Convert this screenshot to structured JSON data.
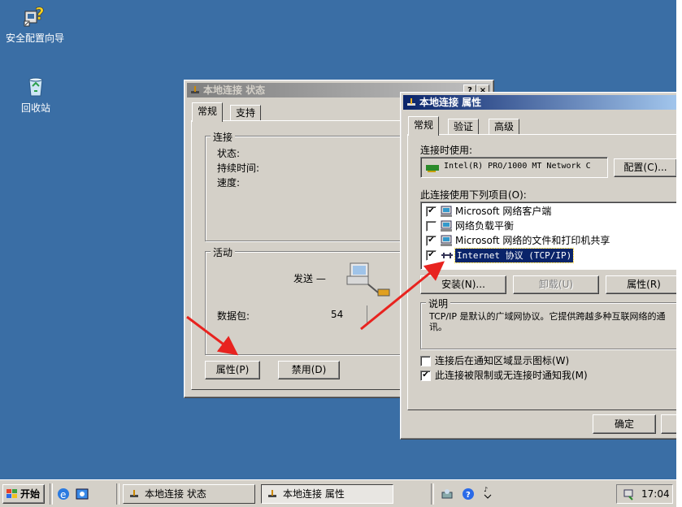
{
  "desktop": {
    "icons": [
      {
        "label": "安全配置向导",
        "icon": "security-wizard-icon"
      },
      {
        "label": "回收站",
        "icon": "recycle-bin-icon"
      }
    ]
  },
  "status_window": {
    "title": "本地连接 状态",
    "help_btn": "?",
    "close_btn": "×",
    "tabs": [
      "常规",
      "支持"
    ],
    "connection_group": "连接",
    "status_label": "状态:",
    "duration_label": "持续时间:",
    "speed_label": "速度:",
    "activity_group": "活动",
    "sent_label": "发送 —",
    "packets_label": "数据包:",
    "packets_sent": "54",
    "properties_btn": "属性(P)",
    "disable_btn": "禁用(D)"
  },
  "props_window": {
    "title": "本地连接 属性",
    "tabs": [
      "常规",
      "验证",
      "高级"
    ],
    "connect_using_label": "连接时使用:",
    "adapter_name": "Intel(R) PRO/1000 MT Network C",
    "configure_btn": "配置(C)...",
    "items_label": "此连接使用下列项目(O):",
    "items": [
      {
        "label": "Microsoft 网络客户端",
        "checked": true,
        "icon": "network-client-icon"
      },
      {
        "label": "网络负载平衡",
        "checked": false,
        "icon": "load-balance-icon"
      },
      {
        "label": "Microsoft 网络的文件和打印机共享",
        "checked": true,
        "icon": "file-share-icon"
      },
      {
        "label": "Internet 协议 (TCP/IP)",
        "checked": true,
        "icon": "protocol-icon",
        "selected": true
      }
    ],
    "install_btn": "安装(N)...",
    "uninstall_btn": "卸载(U)",
    "properties_btn": "属性(R)",
    "description_group": "说明",
    "description_text": "TCP/IP 是默认的广域网协议。它提供跨越多种互联网络的通讯。",
    "show_icon_label": "连接后在通知区域显示图标(W)",
    "show_icon_checked": false,
    "notify_label": "此连接被限制或无连接时通知我(M)",
    "notify_checked": true,
    "ok_btn": "确定"
  },
  "taskbar": {
    "start_label": "开始",
    "tasks": [
      {
        "label": "本地连接 状态",
        "pressed": false
      },
      {
        "label": "本地连接 属性",
        "pressed": true
      }
    ],
    "clock": "17:04"
  },
  "colors": {
    "desktop": "#3a6ea5",
    "title_active": "#0a246a",
    "annotation_arrow": "#e8231f"
  }
}
